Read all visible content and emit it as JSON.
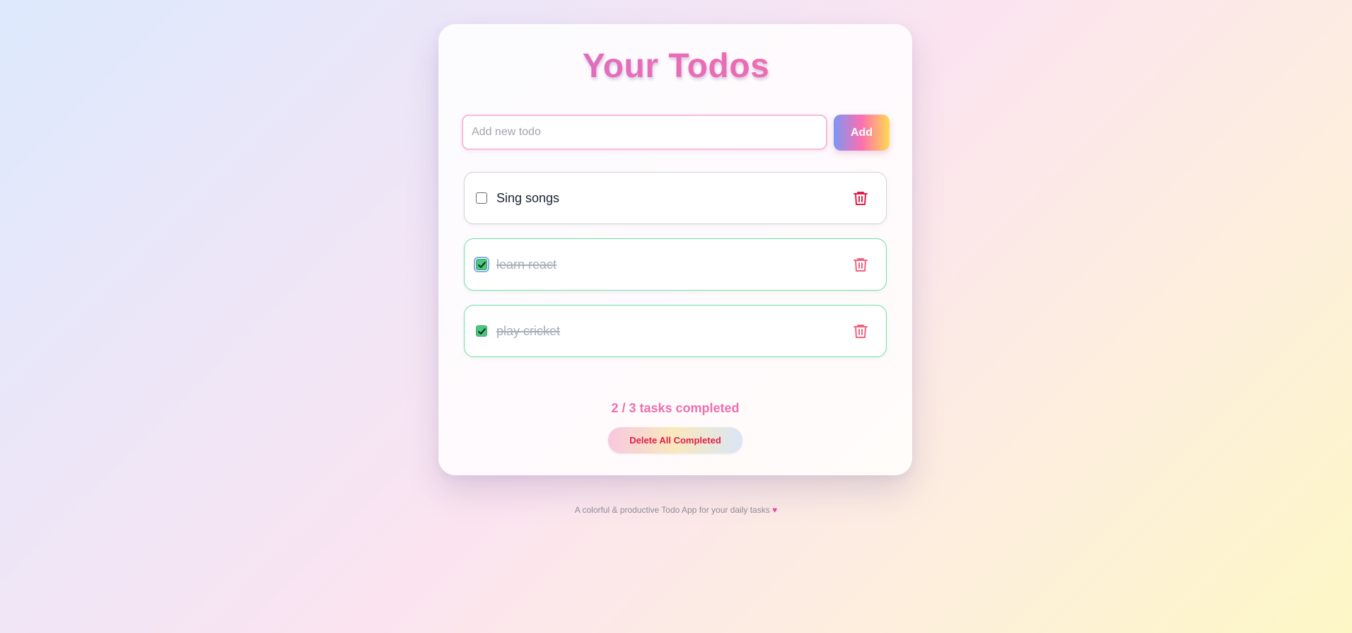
{
  "app": {
    "title": "Your Todos"
  },
  "new_todo": {
    "placeholder": "Add new todo",
    "value": "",
    "add_label": "Add"
  },
  "todos": [
    {
      "text": "Sing songs",
      "completed": false
    },
    {
      "text": "learn react",
      "completed": true
    },
    {
      "text": "play cricket",
      "completed": true
    }
  ],
  "summary": {
    "text": "2 / 3 tasks completed"
  },
  "actions": {
    "delete_completed_label": "Delete All Completed"
  },
  "footer": {
    "text": "A colorful & productive Todo App for your daily tasks",
    "heart": "♥"
  },
  "icons": {
    "delete": "trash-icon",
    "checkmark": "check-icon"
  },
  "colors": {
    "accent_pink": "#ec4899",
    "completed_green": "#4bc780",
    "danger_red": "#e11d48"
  }
}
